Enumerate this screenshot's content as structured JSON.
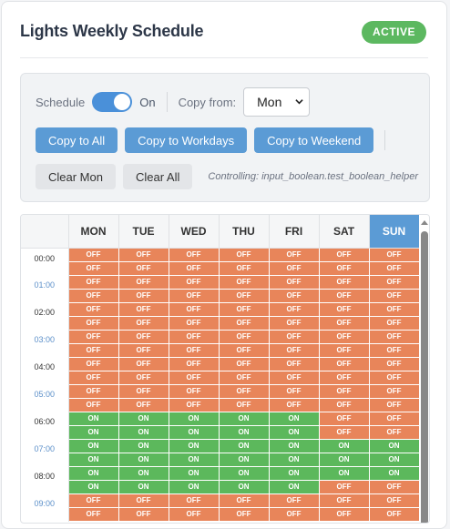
{
  "header": {
    "title": "Lights Weekly Schedule",
    "status": "ACTIVE"
  },
  "colors": {
    "accent": "#5b9bd5",
    "on": "#5cb85c",
    "off": "#e8855a",
    "active_badge": "#5cb860"
  },
  "controls": {
    "schedule_label": "Schedule",
    "toggle_state": "On",
    "copy_from_label": "Copy from:",
    "copy_from_value": "Mon",
    "buttons": {
      "copy_all": "Copy to All",
      "copy_workdays": "Copy to Workdays",
      "copy_weekend": "Copy to Weekend",
      "clear_day": "Clear Mon",
      "clear_all": "Clear All"
    },
    "controlling_text": "Controlling: input_boolean.test_boolean_helper"
  },
  "grid": {
    "days": [
      "MON",
      "TUE",
      "WED",
      "THU",
      "FRI",
      "SAT",
      "SUN"
    ],
    "highlighted_day": "SUN",
    "hours": [
      "00:00",
      "01:00",
      "02:00",
      "03:00",
      "04:00",
      "05:00",
      "06:00",
      "07:00",
      "08:00",
      "09:00"
    ],
    "on_label": "ON",
    "off_label": "OFF",
    "rows": [
      [
        "OFF",
        "OFF",
        "OFF",
        "OFF",
        "OFF",
        "OFF",
        "OFF"
      ],
      [
        "OFF",
        "OFF",
        "OFF",
        "OFF",
        "OFF",
        "OFF",
        "OFF"
      ],
      [
        "OFF",
        "OFF",
        "OFF",
        "OFF",
        "OFF",
        "OFF",
        "OFF"
      ],
      [
        "OFF",
        "OFF",
        "OFF",
        "OFF",
        "OFF",
        "OFF",
        "OFF"
      ],
      [
        "OFF",
        "OFF",
        "OFF",
        "OFF",
        "OFF",
        "OFF",
        "OFF"
      ],
      [
        "OFF",
        "OFF",
        "OFF",
        "OFF",
        "OFF",
        "OFF",
        "OFF"
      ],
      [
        "OFF",
        "OFF",
        "OFF",
        "OFF",
        "OFF",
        "OFF",
        "OFF"
      ],
      [
        "OFF",
        "OFF",
        "OFF",
        "OFF",
        "OFF",
        "OFF",
        "OFF"
      ],
      [
        "OFF",
        "OFF",
        "OFF",
        "OFF",
        "OFF",
        "OFF",
        "OFF"
      ],
      [
        "OFF",
        "OFF",
        "OFF",
        "OFF",
        "OFF",
        "OFF",
        "OFF"
      ],
      [
        "OFF",
        "OFF",
        "OFF",
        "OFF",
        "OFF",
        "OFF",
        "OFF"
      ],
      [
        "OFF",
        "OFF",
        "OFF",
        "OFF",
        "OFF",
        "OFF",
        "OFF"
      ],
      [
        "ON",
        "ON",
        "ON",
        "ON",
        "ON",
        "OFF",
        "OFF"
      ],
      [
        "ON",
        "ON",
        "ON",
        "ON",
        "ON",
        "OFF",
        "OFF"
      ],
      [
        "ON",
        "ON",
        "ON",
        "ON",
        "ON",
        "ON",
        "ON"
      ],
      [
        "ON",
        "ON",
        "ON",
        "ON",
        "ON",
        "ON",
        "ON"
      ],
      [
        "ON",
        "ON",
        "ON",
        "ON",
        "ON",
        "ON",
        "ON"
      ],
      [
        "ON",
        "ON",
        "ON",
        "ON",
        "ON",
        "OFF",
        "OFF"
      ],
      [
        "OFF",
        "OFF",
        "OFF",
        "OFF",
        "OFF",
        "OFF",
        "OFF"
      ],
      [
        "OFF",
        "OFF",
        "OFF",
        "OFF",
        "OFF",
        "OFF",
        "OFF"
      ]
    ]
  }
}
